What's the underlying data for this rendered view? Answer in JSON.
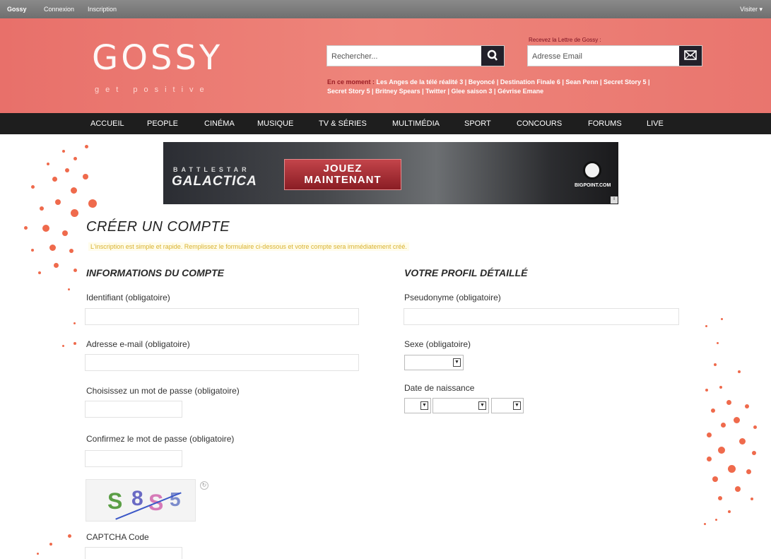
{
  "topbar": {
    "brand": "Gossy",
    "login": "Connexion",
    "signup": "Inscription",
    "visitor": "Visiter ▾"
  },
  "header": {
    "logo": "GOSSY",
    "slogan": "get positive",
    "search_placeholder": "Rechercher...",
    "newsletter_label": "Recevez la Lettre de Gossy :",
    "email_placeholder": "Adresse Email",
    "trending_label": "En ce moment :",
    "trending": [
      "Les Anges de la télé réalité 3",
      "Beyoncé",
      "Destination Finale 6",
      "Sean Penn",
      "Secret Story 5",
      "Secret Story 5",
      "Britney Spears",
      "Twitter",
      "Glee saison 3",
      "Gévrise Emane"
    ]
  },
  "nav": [
    "ACCUEIL",
    "PEOPLE",
    "CINÉMA",
    "MUSIQUE",
    "TV & SÉRIES",
    "MULTIMÉDIA",
    "SPORT",
    "CONCOURS",
    "FORUMS",
    "LIVE"
  ],
  "banner": {
    "series": "BATTLESTAR",
    "name": "GALACTICA",
    "cta_line1": "JOUEZ",
    "cta_line2": "MAINTENANT",
    "sponsor": "BIGPOINT.COM"
  },
  "form": {
    "title": "CRÉER UN COMPTE",
    "intro": "L'inscription est simple et rapide. Remplissez le formulaire ci-dessous et votre compte sera immédiatement créé.",
    "account_heading": "INFORMATIONS DU COMPTE",
    "profile_heading": "VOTRE PROFIL DÉTAILLÉ",
    "username_label": "Identifiant (obligatoire)",
    "email_label": "Adresse e-mail (obligatoire)",
    "password_label": "Choisissez un mot de passe (obligatoire)",
    "confirm_label": "Confirmez le mot de passe (obligatoire)",
    "captcha_text": [
      "S",
      "8",
      "S",
      "5"
    ],
    "captcha_label": "CAPTCHA Code",
    "pseudo_label": "Pseudonyme (obligatoire)",
    "sex_label": "Sexe (obligatoire)",
    "birth_label": "Date de naissance"
  },
  "colors": {
    "header": "#ee857b",
    "nav": "#1e1e1e",
    "accent_dots": "#ef6a4c"
  }
}
